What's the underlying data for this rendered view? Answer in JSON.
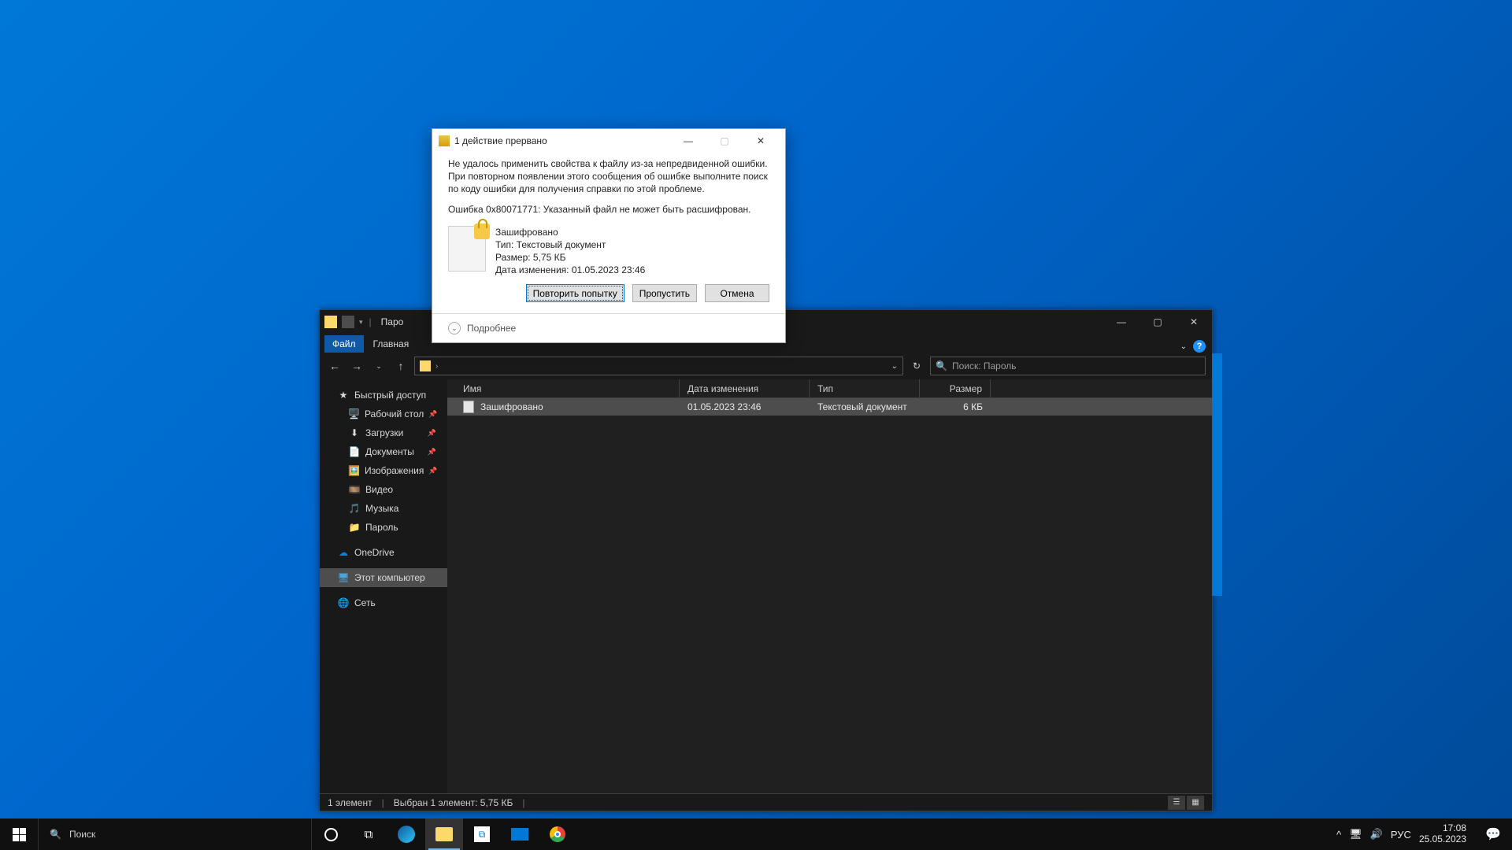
{
  "explorer": {
    "title": "Паро",
    "tabs": {
      "file": "Файл",
      "home": "Главная"
    },
    "nav": {
      "quick_access": "Быстрый доступ",
      "items": [
        {
          "label": "Рабочий стол",
          "icon": "🖥️",
          "pin": true
        },
        {
          "label": "Загрузки",
          "icon": "⬇",
          "pin": true
        },
        {
          "label": "Документы",
          "icon": "📄",
          "pin": true
        },
        {
          "label": "Изображения",
          "icon": "🖼️",
          "pin": true
        },
        {
          "label": "Видео",
          "icon": "🎞️",
          "pin": false
        },
        {
          "label": "Музыка",
          "icon": "🎵",
          "pin": false
        },
        {
          "label": "Пароль",
          "icon": "📁",
          "pin": false
        }
      ],
      "onedrive": "OneDrive",
      "thispc": "Этот компьютер",
      "network": "Сеть"
    },
    "search_placeholder": "Поиск: Пароль",
    "columns": {
      "name": "Имя",
      "date": "Дата изменения",
      "type": "Тип",
      "size": "Размер"
    },
    "rows": [
      {
        "name": "Зашифровано",
        "date": "01.05.2023 23:46",
        "type": "Текстовый документ",
        "size": "6 КБ"
      }
    ],
    "status": {
      "count": "1 элемент",
      "selected": "Выбран 1 элемент: 5,75 КБ"
    },
    "details_label": "Подробнее"
  },
  "dialog": {
    "title": "1 действие прервано",
    "message": "Не удалось применить свойства к файлу из-за непредвиденной ошибки. При повторном появлении этого сообщения об ошибке выполните поиск по коду ошибки для получения справки по этой проблеме.",
    "error_line": "Ошибка 0x80071771: Указанный файл не может быть расшифрован.",
    "file": {
      "name": "Зашифровано",
      "type": "Тип: Текстовый документ",
      "size": "Размер: 5,75 КБ",
      "mtime": "Дата изменения: 01.05.2023 23:46"
    },
    "buttons": {
      "retry": "Повторить попытку",
      "skip": "Пропустить",
      "cancel": "Отмена"
    },
    "details": "Подробнее"
  },
  "taskbar": {
    "search_placeholder": "Поиск",
    "lang": "РУС",
    "time": "17:08",
    "date": "25.05.2023"
  }
}
